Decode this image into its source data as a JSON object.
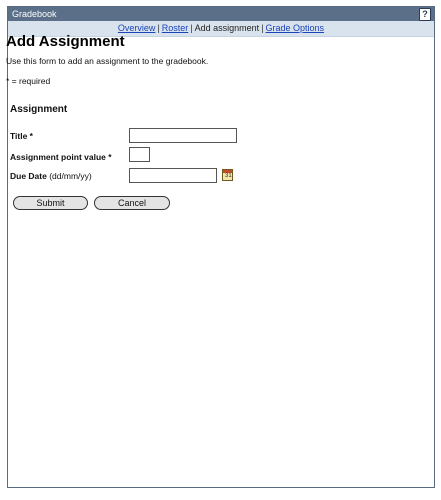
{
  "window": {
    "title": "Gradebook",
    "help_icon": "help-icon"
  },
  "nav": {
    "overview": "Overview",
    "sep1": "|",
    "roster": "Roster",
    "sep2": "|",
    "current": "Add assignment",
    "sep3": "|",
    "grade_options": "Grade Options"
  },
  "page": {
    "title": "Add Assignment",
    "intro": "Use this form to add an assignment to the gradebook.",
    "required_note": "* = required"
  },
  "form": {
    "section_title": "Assignment",
    "title_label": "Title *",
    "title_value": "",
    "points_label": "Assignment point value *",
    "points_value": "",
    "due_label": "Due Date",
    "due_hint": "(dd/mm/yy)",
    "due_value": "",
    "calendar_icon": "calendar-icon"
  },
  "buttons": {
    "submit": "Submit",
    "cancel": "Cancel"
  }
}
